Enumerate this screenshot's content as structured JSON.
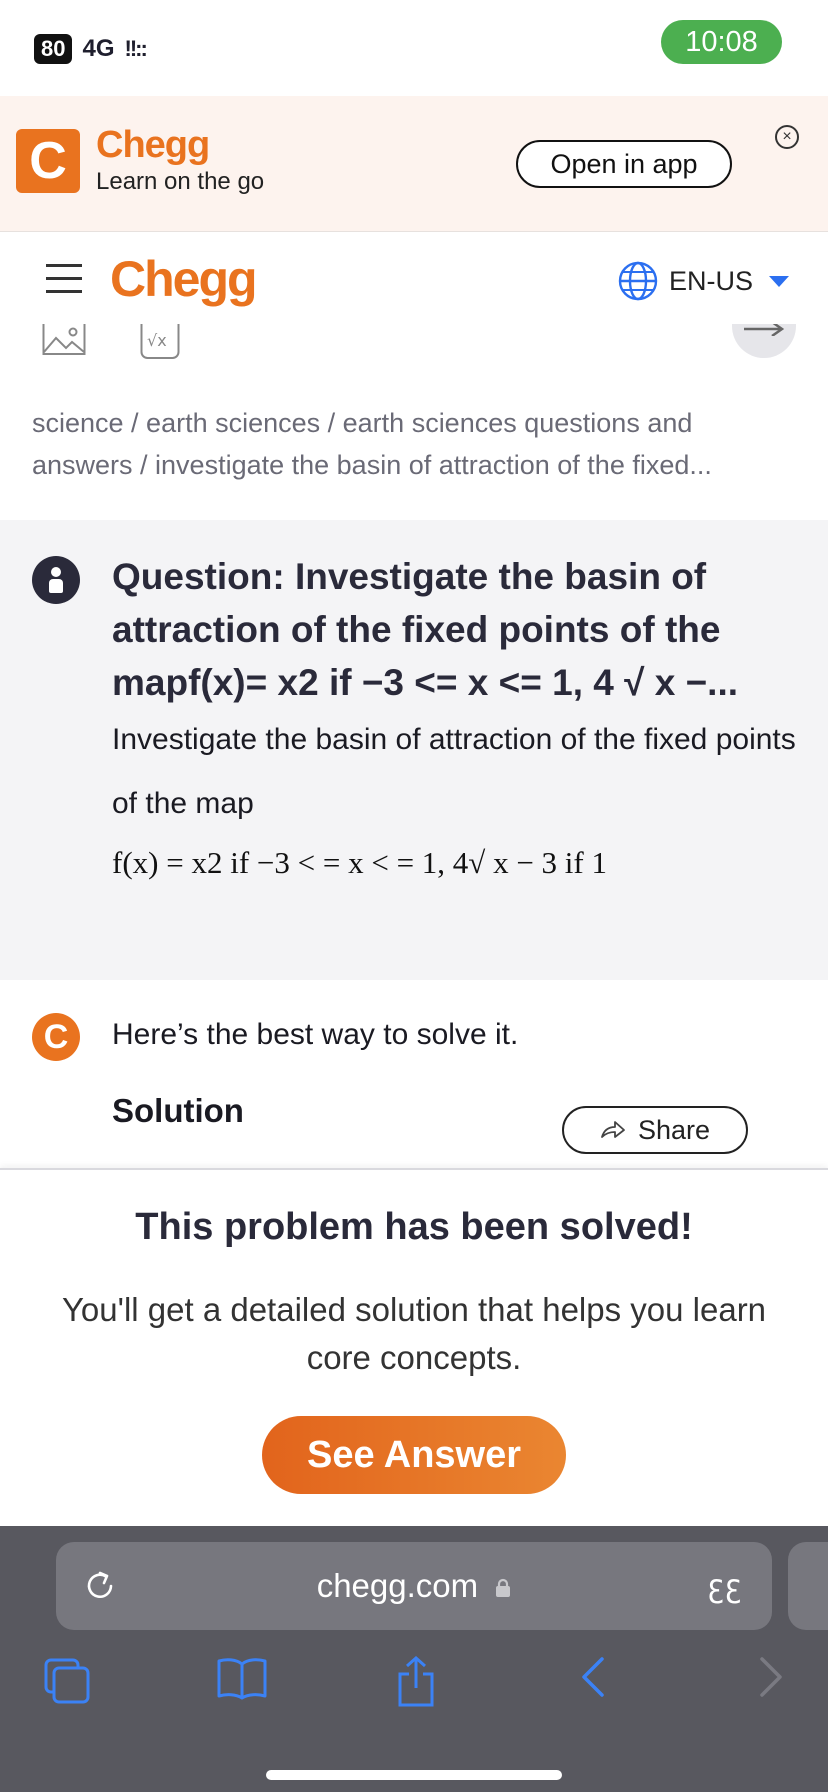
{
  "status_bar": {
    "battery": "80",
    "network": "4G",
    "signal_bars": "!!::",
    "time": "10:08"
  },
  "app_banner": {
    "logo_letter": "C",
    "brand": "Chegg",
    "tagline": "Learn on the go",
    "open_button": "Open in app",
    "close_glyph": "×"
  },
  "header": {
    "brand": "Chegg",
    "language": "EN-US"
  },
  "breadcrumb": {
    "line1": "science / earth sciences / earth sciences questions and",
    "line2": "answers / investigate the basin of attraction of the fixed..."
  },
  "question": {
    "title": "Question: Investigate the basin of attraction of the fixed points of the mapf(x)= x2 if −3 <= x <= 1, 4 √ x −...",
    "body": "Investigate the basin of attraction of the fixed points of the map",
    "formula": "f(x) = x2 if −3 < = x < = 1, 4√ x − 3 if 1"
  },
  "solution": {
    "logo_letter": "C",
    "intro": "Here’s the best way to solve it.",
    "title": "Solution",
    "share_button": "Share"
  },
  "solved_panel": {
    "heading": "This problem has been solved!",
    "description": "You'll get a detailed solution that helps you learn core concepts.",
    "cta": "See Answer"
  },
  "browser": {
    "url": "chegg.com",
    "reader_glyph": "ꜫꜫ"
  },
  "colors": {
    "brand_orange": "#e9731f",
    "status_green": "#4caf50",
    "ios_blue": "#2b6ff0"
  }
}
